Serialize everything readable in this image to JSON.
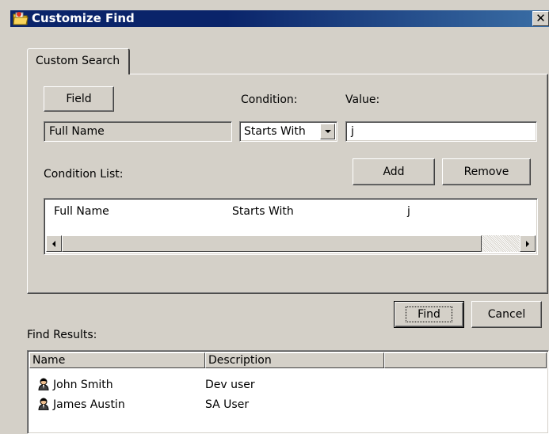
{
  "window": {
    "title": "Customize Find",
    "close_glyph": "✕"
  },
  "tabs": [
    {
      "label": "Custom Search"
    }
  ],
  "search": {
    "field_button": "Field",
    "condition_label": "Condition:",
    "value_label": "Value:",
    "field_value": "Full Name",
    "condition_selected": "Starts With",
    "value_input": "j",
    "condition_list_label": "Condition List:",
    "add_button": "Add",
    "remove_button": "Remove"
  },
  "condition_list": {
    "rows": [
      {
        "field": "Full Name",
        "condition": "Starts With",
        "value": "j"
      }
    ]
  },
  "actions": {
    "find_button": "Find",
    "cancel_button": "Cancel"
  },
  "results": {
    "label": "Find Results:",
    "columns": [
      "Name",
      "Description"
    ],
    "rows": [
      {
        "name": "John Smith",
        "description": "Dev user",
        "icon": "user-icon"
      },
      {
        "name": "James Austin",
        "description": "SA User",
        "icon": "user-icon"
      }
    ]
  },
  "colors": {
    "title_bar": "#0a246a",
    "dialog_bg": "#d4d0c8"
  }
}
